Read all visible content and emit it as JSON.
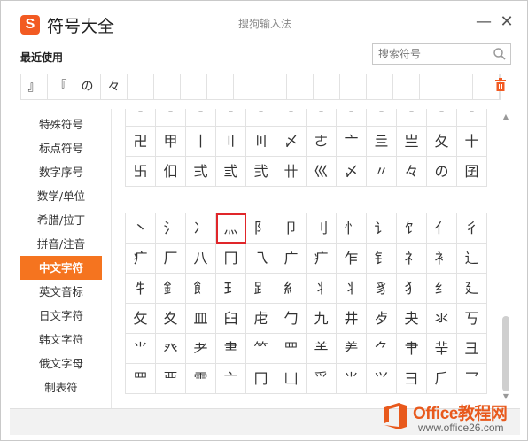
{
  "titlebar": {
    "logo_text": "S",
    "title": "符号大全",
    "subtitle": "搜狗输入法",
    "minimize": "—",
    "close": "✕"
  },
  "recent": {
    "label": "最近使用",
    "items": [
      "』",
      "『",
      "の",
      "々",
      "",
      "",
      "",
      "",
      "",
      "",
      "",
      "",
      "",
      "",
      "",
      "",
      "",
      ""
    ]
  },
  "search": {
    "placeholder": "搜索符号"
  },
  "sidebar": {
    "items": [
      "特殊符号",
      "标点符号",
      "数字序号",
      "数学/单位",
      "希腊/拉丁",
      "拼音/注音",
      "中文字符",
      "英文音标",
      "日文字符",
      "韩文字符",
      "俄文字母",
      "制表符"
    ],
    "active_index": 6
  },
  "grid_top": [
    [
      "-",
      "-",
      "-",
      "-",
      "-",
      "-",
      "-",
      "-",
      "-",
      "-",
      "-",
      "-"
    ],
    [
      "卍",
      "甲",
      "丨",
      "〢",
      "〣",
      "〆",
      "ㄜ",
      "亠",
      "亖",
      "亗",
      "夂",
      "十"
    ],
    [
      "卐",
      "㐰",
      "弍",
      "弎",
      "弐",
      "卄",
      "巛",
      "〆",
      "〃",
      "々",
      "の",
      "囝"
    ]
  ],
  "grid_bottom": [
    [
      "丶",
      "氵",
      "冫",
      "灬",
      "阝",
      "卩",
      "刂",
      "忄",
      "讠",
      "饣",
      "亻",
      "彳"
    ],
    [
      "疒",
      "厂",
      "八",
      "冂",
      "乁",
      "广",
      "疒",
      "乍",
      "钅",
      "礻",
      "衤",
      "辶"
    ],
    [
      "牜",
      "釒",
      "飠",
      "𤣩",
      "𧾷",
      "糹",
      "丬",
      "丬",
      "豸",
      "犭",
      "纟",
      "廴"
    ],
    [
      "攵",
      "夊",
      "皿",
      "臼",
      "虍",
      "勹",
      "九",
      "井",
      "歺",
      "夬",
      "氺",
      "丂"
    ],
    [
      "⺌",
      "癶",
      "耂",
      "⺻",
      "⺮",
      "罒",
      "⺷",
      "⺶",
      "⺈",
      "⺺",
      "⺸",
      "⼹"
    ],
    [
      "罒",
      "覀",
      "⻗",
      "⼇",
      "⼌",
      "⼐",
      "⺤",
      "⺌",
      "⺍",
      "⺕",
      "⺁",
      "⺂"
    ]
  ],
  "selected_cell": "灬",
  "watermark": {
    "title": "Office教程网",
    "url": "www.office26.com"
  }
}
